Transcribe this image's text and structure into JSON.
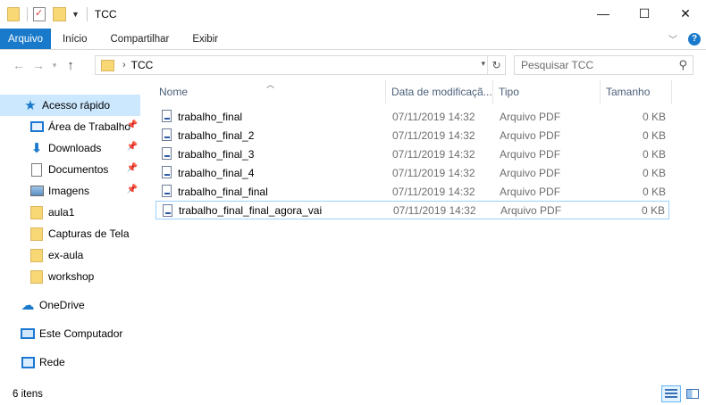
{
  "window": {
    "title": "TCC",
    "minimize": "—",
    "maximize": "☐",
    "close": "✕"
  },
  "ribbon": {
    "tabs": [
      {
        "label": "Arquivo",
        "active": true
      },
      {
        "label": "Início"
      },
      {
        "label": "Compartilhar"
      },
      {
        "label": "Exibir"
      }
    ],
    "help": "?"
  },
  "address": {
    "breadcrumb": [
      "TCC"
    ],
    "search_placeholder": "Pesquisar TCC"
  },
  "navpane": {
    "items": [
      {
        "label": "Acesso rápido",
        "icon": "star-icon",
        "selected": true
      },
      {
        "label": "Área de Trabalho",
        "icon": "desktop-icon",
        "pinned": true
      },
      {
        "label": "Downloads",
        "icon": "download-icon",
        "pinned": true
      },
      {
        "label": "Documentos",
        "icon": "document-icon",
        "pinned": true
      },
      {
        "label": "Imagens",
        "icon": "images-icon",
        "pinned": true
      },
      {
        "label": "aula1",
        "icon": "folder-icon"
      },
      {
        "label": "Capturas de Tela",
        "icon": "folder-icon"
      },
      {
        "label": "ex-aula",
        "icon": "folder-icon"
      },
      {
        "label": "workshop",
        "icon": "folder-icon"
      },
      {
        "label": "OneDrive",
        "icon": "cloud-icon"
      },
      {
        "label": "Este Computador",
        "icon": "computer-icon"
      },
      {
        "label": "Rede",
        "icon": "network-icon"
      }
    ]
  },
  "columns": {
    "name": "Nome",
    "date": "Data de modificaçã...",
    "type": "Tipo",
    "size": "Tamanho"
  },
  "files": [
    {
      "name": "trabalho_final",
      "date": "07/11/2019 14:32",
      "type": "Arquivo PDF",
      "size": "0 KB"
    },
    {
      "name": "trabalho_final_2",
      "date": "07/11/2019 14:32",
      "type": "Arquivo PDF",
      "size": "0 KB"
    },
    {
      "name": "trabalho_final_3",
      "date": "07/11/2019 14:32",
      "type": "Arquivo PDF",
      "size": "0 KB"
    },
    {
      "name": "trabalho_final_4",
      "date": "07/11/2019 14:32",
      "type": "Arquivo PDF",
      "size": "0 KB"
    },
    {
      "name": "trabalho_final_final",
      "date": "07/11/2019 14:32",
      "type": "Arquivo PDF",
      "size": "0 KB"
    },
    {
      "name": "trabalho_final_final_agora_vai",
      "date": "07/11/2019 14:32",
      "type": "Arquivo PDF",
      "size": "0 KB",
      "focused": true
    }
  ],
  "status": {
    "item_count": "6 itens"
  },
  "colors": {
    "accent": "#1979ca",
    "selection": "#cce8ff",
    "column_header_text": "#4c607a"
  }
}
